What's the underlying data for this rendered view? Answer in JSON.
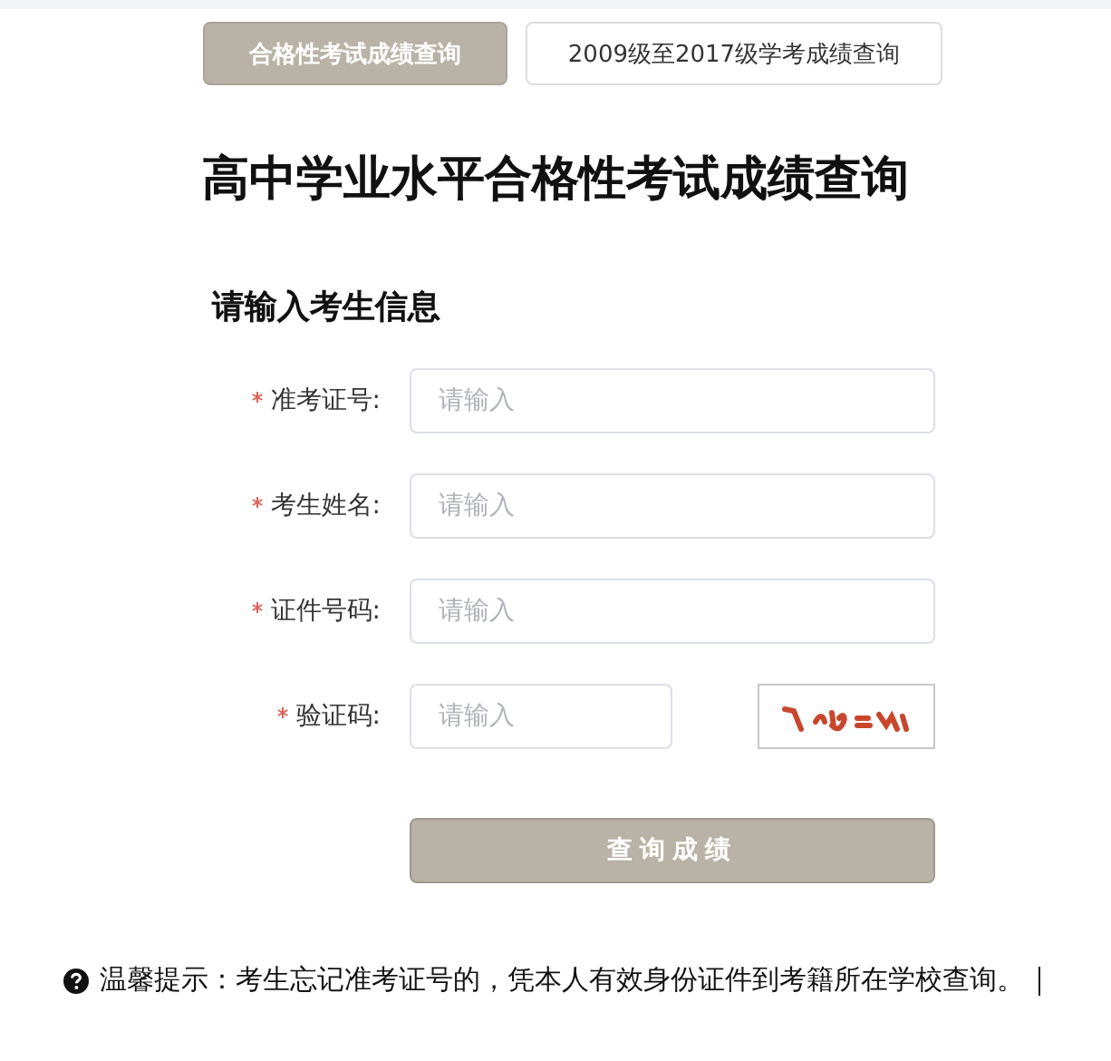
{
  "tabs": [
    {
      "label": "合格性考试成绩查询",
      "selected": true
    },
    {
      "label": "2009级至2017级学考成绩查询",
      "selected": false
    }
  ],
  "title": "高中学业水平合格性考试成绩查询",
  "form": {
    "heading": "请输入考生信息",
    "fields": [
      {
        "label": "准考证号:",
        "required": true,
        "placeholder": "请输入",
        "kind": "text"
      },
      {
        "label": "考生姓名:",
        "required": true,
        "placeholder": "请输入",
        "kind": "text"
      },
      {
        "label": "证件号码:",
        "required": true,
        "placeholder": "请输入",
        "kind": "text"
      },
      {
        "label": "验证码:",
        "required": true,
        "placeholder": "请输入",
        "kind": "captcha"
      }
    ],
    "submit": "查询成绩"
  },
  "tip": {
    "text": "温馨提示：考生忘记准考证号的，凭本人有效身份证件到考籍所在学校查询。"
  }
}
